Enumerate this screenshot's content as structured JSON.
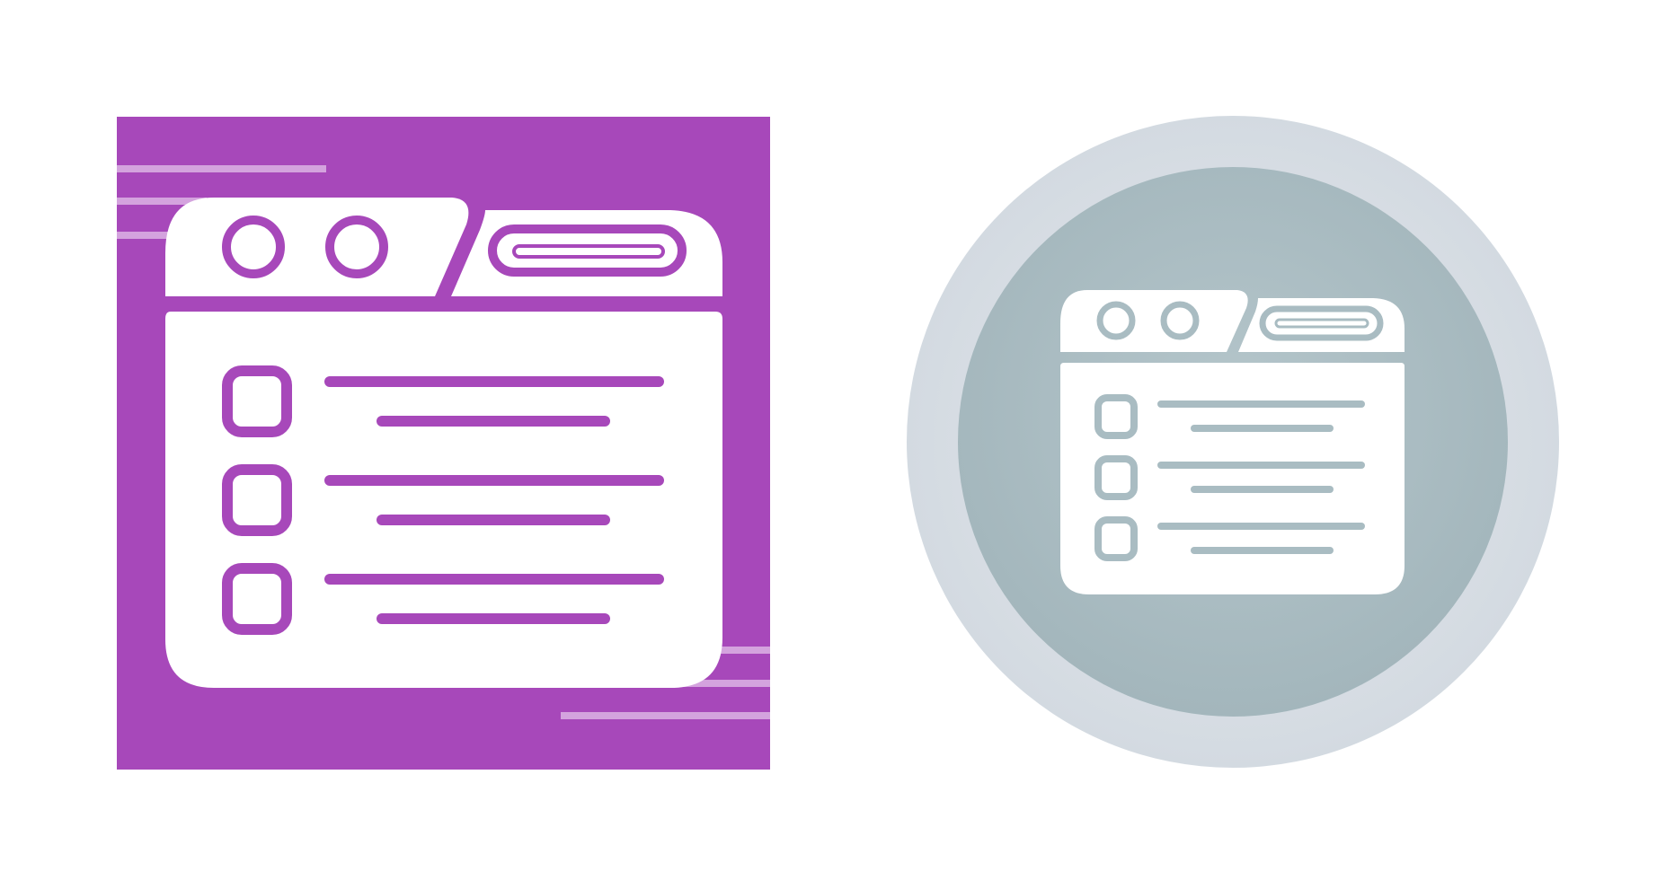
{
  "icons": [
    {
      "name": "checklist-window-icon-purple",
      "style": "square-tile",
      "colors": {
        "background": "#A748BA",
        "accent_line": "#D4A3DE",
        "window_fill": "#FFFFFF",
        "stroke": "#A748BA"
      },
      "checklist_rows": 3
    },
    {
      "name": "checklist-window-icon-gray",
      "style": "round-badge",
      "colors": {
        "outer_ring": "#D9DFE5",
        "inner_disc": "#A9BCC2",
        "window_fill": "#FFFFFF",
        "stroke": "#A9BCC2"
      },
      "checklist_rows": 3
    }
  ]
}
